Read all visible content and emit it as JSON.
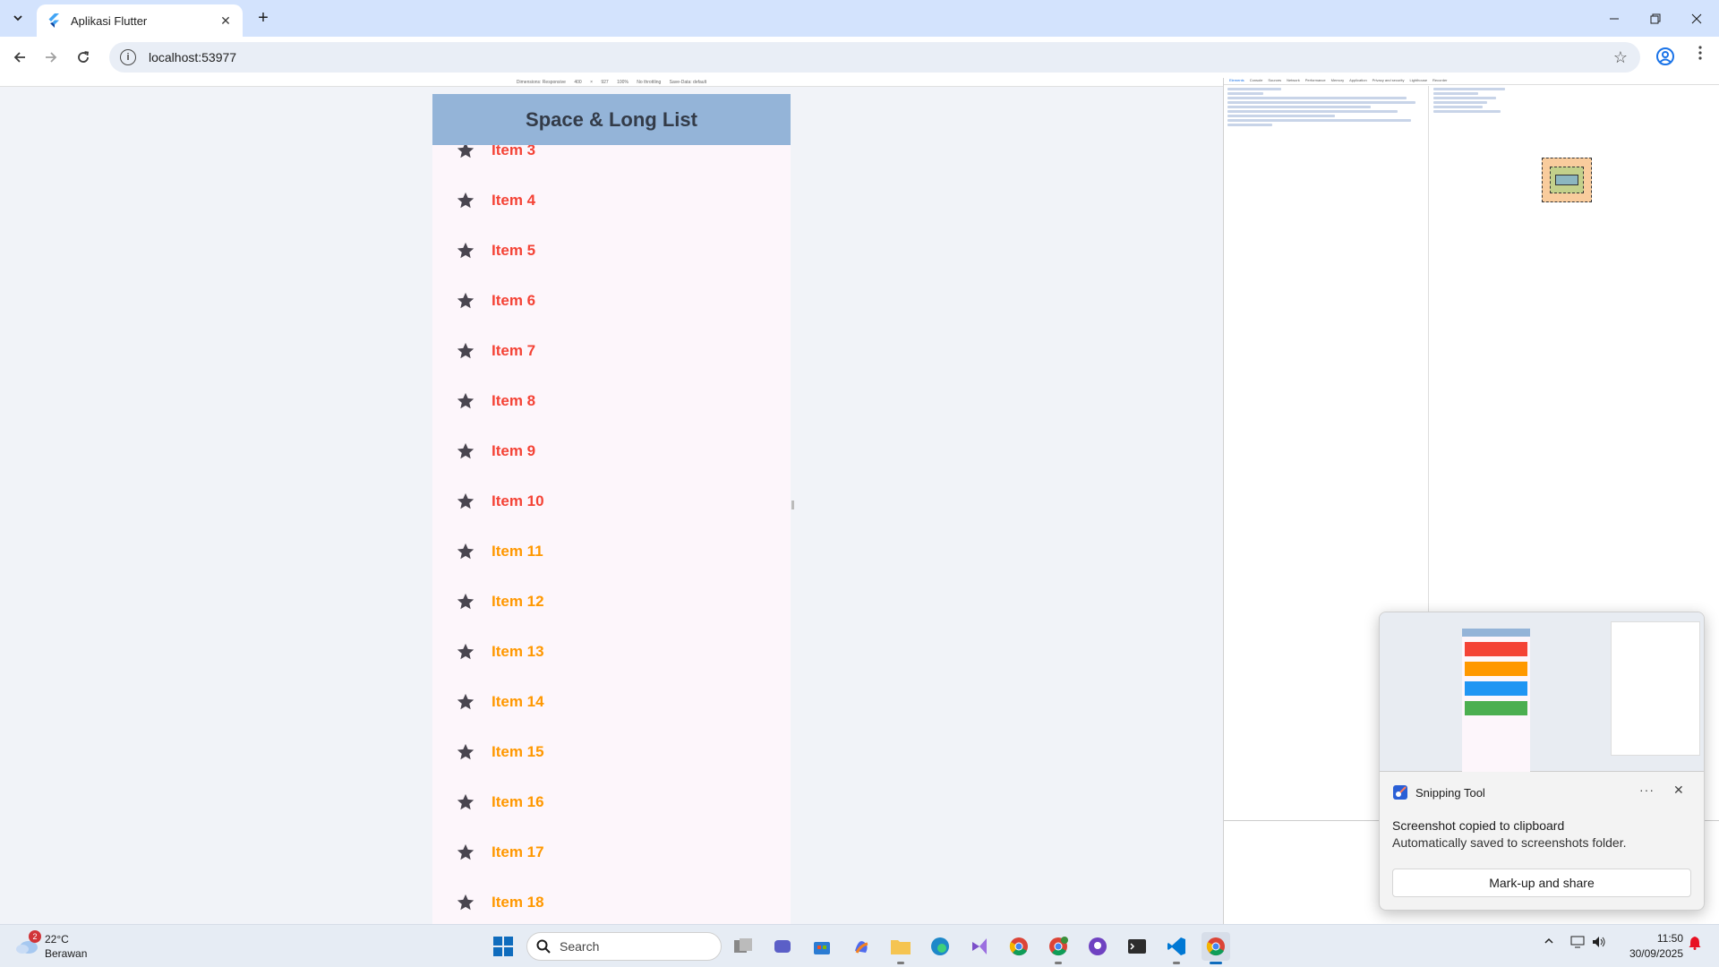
{
  "browser": {
    "tab_title": "Aplikasi Flutter",
    "url": "localhost:53977"
  },
  "device_toolbar": {
    "items": [
      "Dimensions: Responsive",
      "400",
      "×",
      "927",
      "100%",
      "No throttling",
      "Save-Data: default"
    ]
  },
  "app": {
    "title": "Space & Long List",
    "items": [
      {
        "label": "Item 3",
        "color": "#f44336"
      },
      {
        "label": "Item 4",
        "color": "#f44336"
      },
      {
        "label": "Item 5",
        "color": "#f44336"
      },
      {
        "label": "Item 6",
        "color": "#f44336"
      },
      {
        "label": "Item 7",
        "color": "#f44336"
      },
      {
        "label": "Item 8",
        "color": "#f44336"
      },
      {
        "label": "Item 9",
        "color": "#f44336"
      },
      {
        "label": "Item 10",
        "color": "#f44336"
      },
      {
        "label": "Item 11",
        "color": "#ff9800"
      },
      {
        "label": "Item 12",
        "color": "#ff9800"
      },
      {
        "label": "Item 13",
        "color": "#ff9800"
      },
      {
        "label": "Item 14",
        "color": "#ff9800"
      },
      {
        "label": "Item 15",
        "color": "#ff9800"
      },
      {
        "label": "Item 16",
        "color": "#ff9800"
      },
      {
        "label": "Item 17",
        "color": "#ff9800"
      },
      {
        "label": "Item 18",
        "color": "#ff9800"
      }
    ],
    "icon_color": "#49454f",
    "appbar_color": "#94b4d8"
  },
  "devtools": {
    "tabs": [
      "Elements",
      "Console",
      "Sources",
      "Network",
      "Performance",
      "Memory",
      "Application",
      "Privacy and security",
      "Lighthouse",
      "Recorder"
    ]
  },
  "toast": {
    "app_name": "Snipping Tool",
    "title": "Screenshot copied to clipboard",
    "body": "Automatically saved to screenshots folder.",
    "button": "Mark-up and share"
  },
  "taskbar": {
    "weather_temp": "22°C",
    "weather_desc": "Berawan",
    "weather_badge": "2",
    "search_label": "Search",
    "time": "11:50",
    "date": "30/09/2025"
  }
}
